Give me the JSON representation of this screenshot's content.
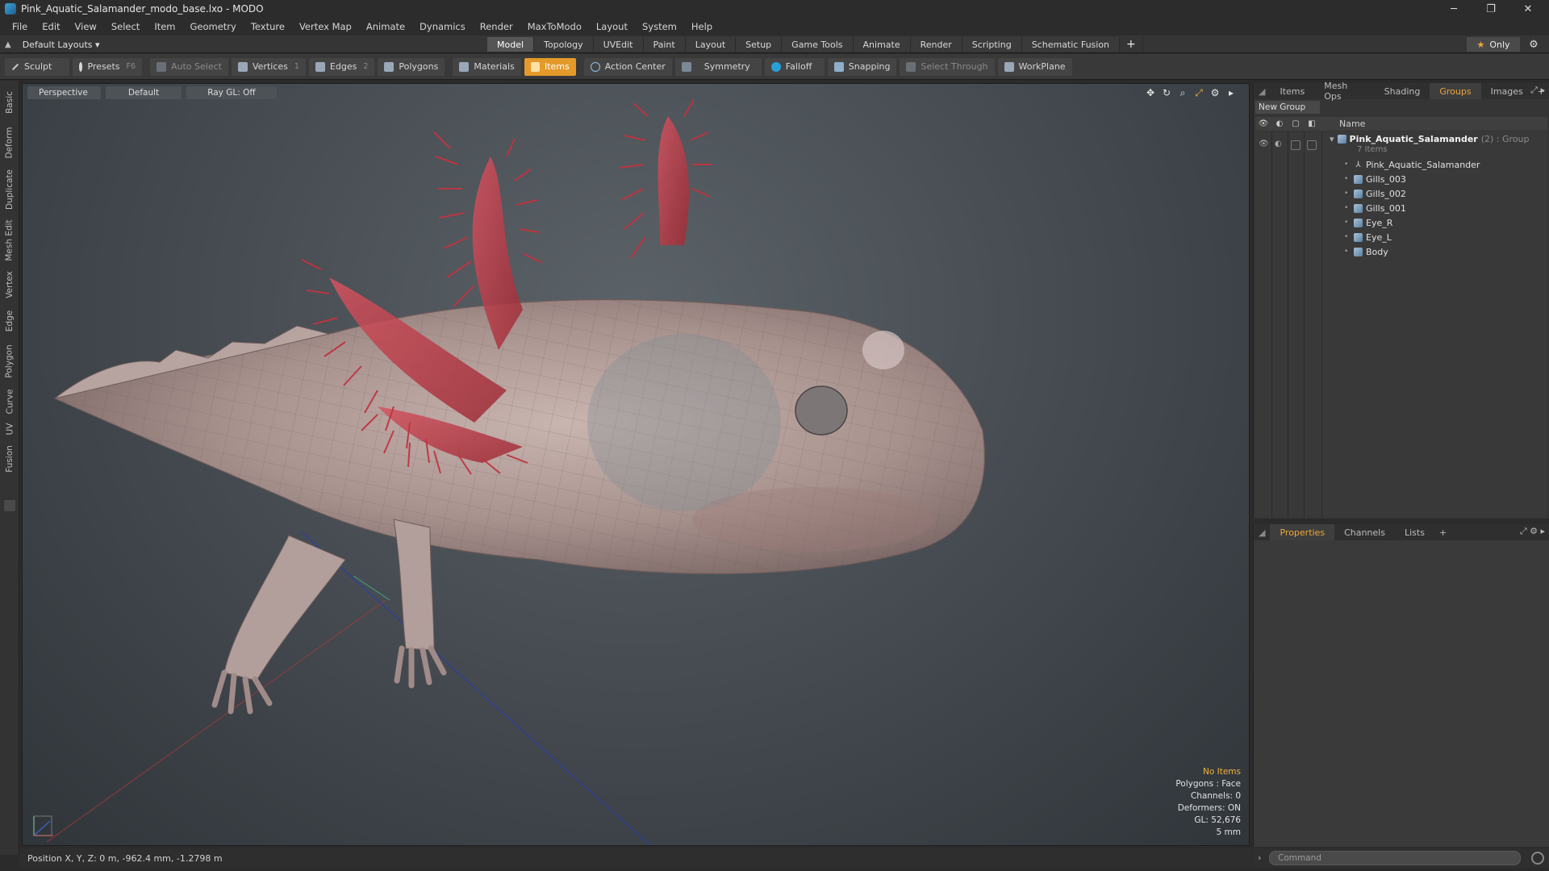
{
  "window": {
    "title": "Pink_Aquatic_Salamander_modo_base.lxo - MODO",
    "minimize": "─",
    "maximize": "❐",
    "close": "✕"
  },
  "menu": [
    "File",
    "Edit",
    "View",
    "Select",
    "Item",
    "Geometry",
    "Texture",
    "Vertex Map",
    "Animate",
    "Dynamics",
    "Render",
    "MaxToModo",
    "Layout",
    "System",
    "Help"
  ],
  "layout": {
    "selector": "Default Layouts ▾",
    "tabs": [
      "Model",
      "Topology",
      "UVEdit",
      "Paint",
      "Layout",
      "Setup",
      "Game Tools",
      "Animate",
      "Render",
      "Scripting",
      "Schematic Fusion"
    ],
    "active_tab": "Model",
    "only_label": "Only"
  },
  "toolbar": {
    "sculpt": "Sculpt",
    "presets": "Presets",
    "presets_key": "F6",
    "auto_select": "Auto Select",
    "vertices": "Vertices",
    "vertices_key": "1",
    "edges": "Edges",
    "edges_key": "2",
    "polygons": "Polygons",
    "materials": "Materials",
    "items": "Items",
    "action_center": "Action Center",
    "symmetry": "Symmetry",
    "falloff": "Falloff",
    "snapping": "Snapping",
    "select_through": "Select Through",
    "workplane": "WorkPlane"
  },
  "left_tabs": [
    "Basic",
    "Deform",
    "Duplicate",
    "Mesh Edit",
    "Vertex",
    "Edge",
    "Polygon",
    "Curve",
    "UV",
    "Fusion"
  ],
  "viewport": {
    "view": "Perspective",
    "shading": "Default",
    "raygl": "Ray GL: Off",
    "info": {
      "selection": "No Items",
      "polygons": "Polygons : Face",
      "channels": "Channels: 0",
      "deformers": "Deformers: ON",
      "gl": "GL: 52,676",
      "scale": "5 mm"
    }
  },
  "status": {
    "position": "Position X, Y, Z:  0 m, -962.4 mm, -1.2798 m"
  },
  "right_top": {
    "tabs": [
      "Items",
      "Mesh Ops",
      "Shading",
      "Groups",
      "Images"
    ],
    "active_tab": "Groups",
    "new_group": "New Group",
    "name_header": "Name",
    "group": {
      "name": "Pink_Aquatic_Salamander",
      "meta": "(2) : Group",
      "count": "7 Items",
      "items": [
        "Pink_Aquatic_Salamander",
        "Gills_003",
        "Gills_002",
        "Gills_001",
        "Eye_R",
        "Eye_L",
        "Body"
      ]
    }
  },
  "right_bottom": {
    "tabs": [
      "Properties",
      "Channels",
      "Lists"
    ],
    "active_tab": "Properties"
  },
  "command": {
    "placeholder": "Command"
  },
  "colors": {
    "accent": "#f0a63a",
    "items_button": "#e39a2a",
    "viewport_bg": "#474d53",
    "gill_red": "#c0343f"
  }
}
